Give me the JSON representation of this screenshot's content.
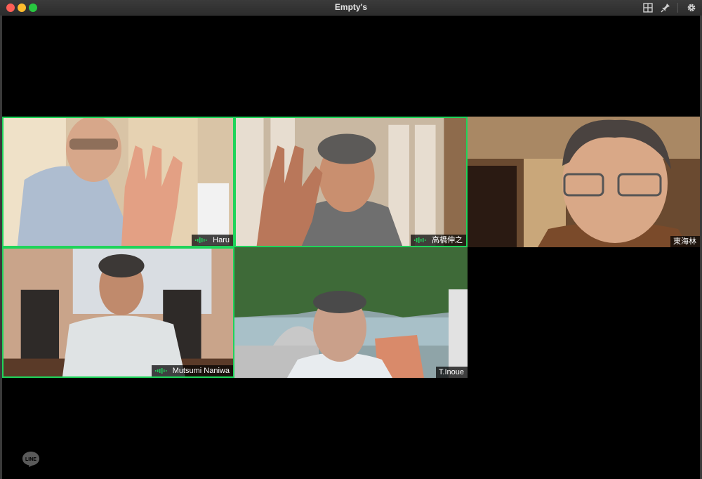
{
  "window": {
    "title": "Empty's",
    "icons": [
      "grid-view-icon",
      "pin-icon",
      "settings-gear-icon"
    ]
  },
  "participants": [
    {
      "name": "Haru",
      "speaking": true
    },
    {
      "name": "高橋伸之",
      "speaking": true
    },
    {
      "name": "東海林",
      "speaking": false
    },
    {
      "name": "Mutsumi Naniwa",
      "speaking": true
    },
    {
      "name": "T.Inoue",
      "speaking": false
    }
  ],
  "watermark": {
    "label": "LINE"
  },
  "colors": {
    "active_border": "#1fd45a",
    "background": "#000000",
    "titlebar": "#2f2f2f"
  }
}
